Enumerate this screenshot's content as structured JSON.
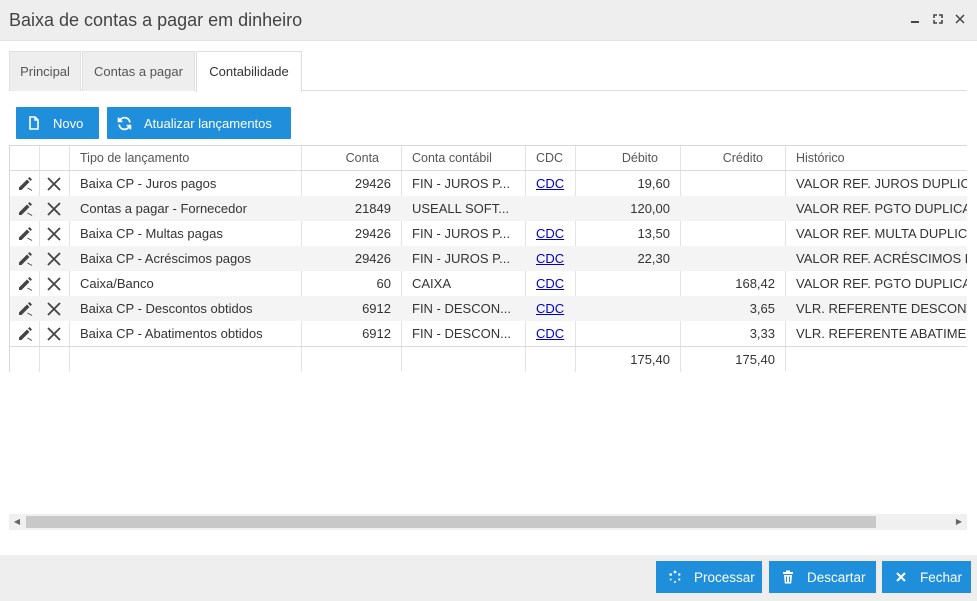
{
  "window": {
    "title": "Baixa de contas a pagar em dinheiro"
  },
  "tabs": [
    {
      "label": "Principal"
    },
    {
      "label": "Contas a pagar"
    },
    {
      "label": "Contabilidade"
    }
  ],
  "toolbar": {
    "new_label": "Novo",
    "refresh_label": "Atualizar lançamentos"
  },
  "grid": {
    "headers": {
      "tipo": "Tipo de lançamento",
      "conta": "Conta",
      "conta_contabil": "Conta contábil",
      "cdc": "CDC",
      "debito": "Débito",
      "credito": "Crédito",
      "historico": "Histórico"
    },
    "rows": [
      {
        "tipo": "Baixa CP - Juros pagos",
        "conta": "29426",
        "conta_contabil": "FIN - JUROS P...",
        "cdc": "CDC",
        "debito": "19,60",
        "credito": "",
        "historico": "VALOR REF. JUROS DUPLICA"
      },
      {
        "tipo": "Contas a pagar - Fornecedor",
        "conta": "21849",
        "conta_contabil": "USEALL SOFT...",
        "cdc": "",
        "debito": "120,00",
        "credito": "",
        "historico": "VALOR REF. PGTO DUPLICAT"
      },
      {
        "tipo": "Baixa CP - Multas pagas",
        "conta": "29426",
        "conta_contabil": "FIN - JUROS P...",
        "cdc": "CDC",
        "debito": "13,50",
        "credito": "",
        "historico": "VALOR REF. MULTA DUPLICA"
      },
      {
        "tipo": "Baixa CP - Acréscimos pagos",
        "conta": "29426",
        "conta_contabil": "FIN - JUROS P...",
        "cdc": "CDC",
        "debito": "22,30",
        "credito": "",
        "historico": "VALOR REF. ACRÉSCIMOS PA"
      },
      {
        "tipo": "Caixa/Banco",
        "conta": "60",
        "conta_contabil": "CAIXA",
        "cdc": "CDC",
        "debito": "",
        "credito": "168,42",
        "historico": "VALOR REF. PGTO DUPLICAT"
      },
      {
        "tipo": "Baixa CP - Descontos obtidos",
        "conta": "6912",
        "conta_contabil": "FIN - DESCON...",
        "cdc": "CDC",
        "debito": "",
        "credito": "3,65",
        "historico": "VLR. REFERENTE DESCONTO"
      },
      {
        "tipo": "Baixa CP - Abatimentos obtidos",
        "conta": "6912",
        "conta_contabil": "FIN - DESCON...",
        "cdc": "CDC",
        "debito": "",
        "credito": "3,33",
        "historico": "VLR. REFERENTE ABATIMEN"
      }
    ],
    "totals": {
      "debito": "175,40",
      "credito": "175,40"
    }
  },
  "footer": {
    "process_label": "Processar",
    "discard_label": "Descartar",
    "close_label": "Fechar"
  },
  "colors": {
    "accent": "#1f8fdb",
    "link": "#0000cc"
  }
}
